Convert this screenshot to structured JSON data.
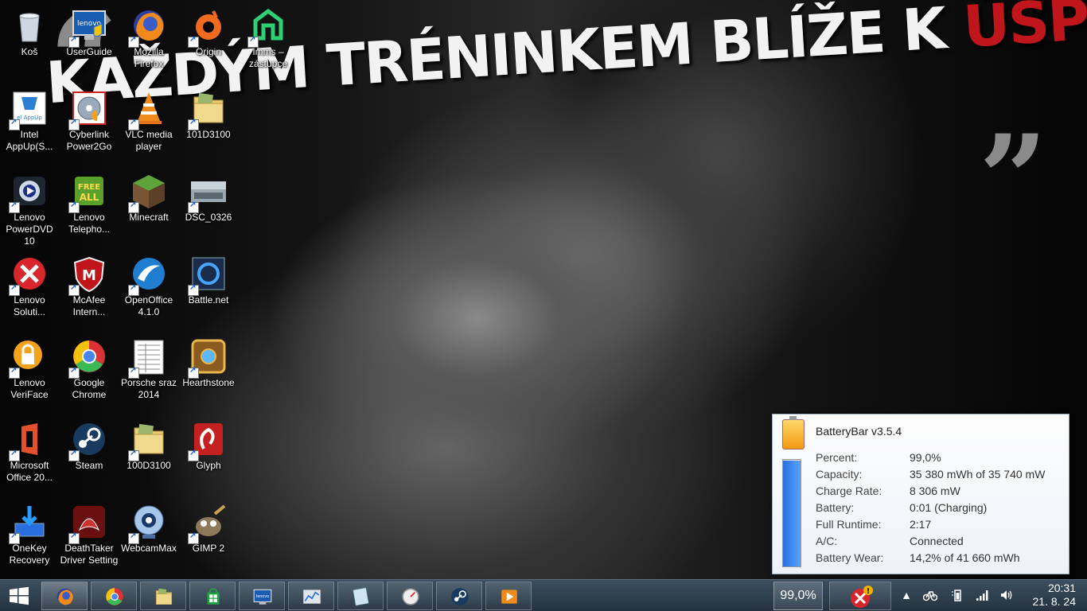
{
  "wallpaper": {
    "headline_white": "KAŽDÝM TRÉNINKEM BLÍŽE K",
    "headline_red": "ÚSPĚCHU",
    "quote_open": "“",
    "quote_close": "”"
  },
  "icons": [
    {
      "label": "Koš",
      "icon": "recycle-bin-icon"
    },
    {
      "label": "UserGuide",
      "icon": "lenovo-userguide-icon"
    },
    {
      "label": "Mozilla\nFirefox",
      "icon": "firefox-icon"
    },
    {
      "label": "Origin",
      "icon": "origin-icon"
    },
    {
      "label": "Imms –\nzástupce",
      "icon": "imms-icon"
    },
    {
      "label": "Intel\nAppUp(S...",
      "icon": "intel-appup-icon"
    },
    {
      "label": "Cyberlink\nPower2Go",
      "icon": "power2go-icon"
    },
    {
      "label": "VLC media\nplayer",
      "icon": "vlc-icon"
    },
    {
      "label": "101D3100",
      "icon": "folder-icon"
    },
    {
      "label": "Lenovo\nPowerDVD 10",
      "icon": "powerdvd-icon"
    },
    {
      "label": "Lenovo\nTelepho...",
      "icon": "lenovo-telephony-icon"
    },
    {
      "label": "Minecraft",
      "icon": "minecraft-icon"
    },
    {
      "label": "DSC_0326",
      "icon": "photo-icon"
    },
    {
      "label": "Lenovo\nSoluti...",
      "icon": "lenovo-solutions-icon"
    },
    {
      "label": "McAfee\nIntern...",
      "icon": "mcafee-icon"
    },
    {
      "label": "OpenOffice\n4.1.0",
      "icon": "openoffice-icon"
    },
    {
      "label": "Battle.net",
      "icon": "battlenet-icon"
    },
    {
      "label": "Lenovo\nVeriFace",
      "icon": "veriface-icon"
    },
    {
      "label": "Google\nChrome",
      "icon": "chrome-icon"
    },
    {
      "label": "Porsche sraz\n2014",
      "icon": "spreadsheet-icon"
    },
    {
      "label": "Hearthstone",
      "icon": "hearthstone-icon"
    },
    {
      "label": "Microsoft\nOffice 20...",
      "icon": "office-icon"
    },
    {
      "label": "Steam",
      "icon": "steam-icon"
    },
    {
      "label": "100D3100",
      "icon": "folder-icon"
    },
    {
      "label": "Glyph",
      "icon": "glyph-icon"
    },
    {
      "label": "OneKey\nRecovery",
      "icon": "onekey-recovery-icon"
    },
    {
      "label": "DeathTaker\nDriver Setting",
      "icon": "deathtaker-icon"
    },
    {
      "label": "WebcamMax",
      "icon": "webcammax-icon"
    },
    {
      "label": "GIMP 2",
      "icon": "gimp-icon"
    }
  ],
  "battery_popup": {
    "title": "BatteryBar v3.5.4",
    "charge_level_percent": 99,
    "rows": [
      {
        "key": "Percent:",
        "value": "99,0%"
      },
      {
        "key": "Capacity:",
        "value": "35 380 mWh of 35 740 mW"
      },
      {
        "key": "Charge Rate:",
        "value": "8 306 mW"
      },
      {
        "key": "Battery:",
        "value": "0:01 (Charging)"
      },
      {
        "key": "Full Runtime:",
        "value": "2:17"
      },
      {
        "key": "A/C:",
        "value": "Connected"
      },
      {
        "key": "Battery Wear:",
        "value": "14,2% of 41 660 mWh"
      }
    ]
  },
  "taskbar": {
    "items": [
      {
        "name": "firefox",
        "icon": "firefox-icon",
        "active": true
      },
      {
        "name": "chrome",
        "icon": "chrome-icon",
        "active": false
      },
      {
        "name": "file-explorer",
        "icon": "folder-icon",
        "active": false
      },
      {
        "name": "store",
        "icon": "store-icon",
        "active": false
      },
      {
        "name": "lenovo",
        "icon": "lenovo-monitor-icon",
        "active": false
      },
      {
        "name": "performance-monitor",
        "icon": "chart-window-icon",
        "active": false
      },
      {
        "name": "notes",
        "icon": "notes-icon",
        "active": false
      },
      {
        "name": "speedometer",
        "icon": "gauge-icon",
        "active": false
      },
      {
        "name": "steam",
        "icon": "steam-icon",
        "active": false
      },
      {
        "name": "media",
        "icon": "media-player-icon",
        "active": false
      }
    ],
    "battery_label": "99,0%",
    "clock_time": "20:31",
    "clock_date": "21. 8. 24",
    "colors": {
      "accent_red": "#c0151a",
      "battery_blue": "#2a6fe0"
    }
  }
}
